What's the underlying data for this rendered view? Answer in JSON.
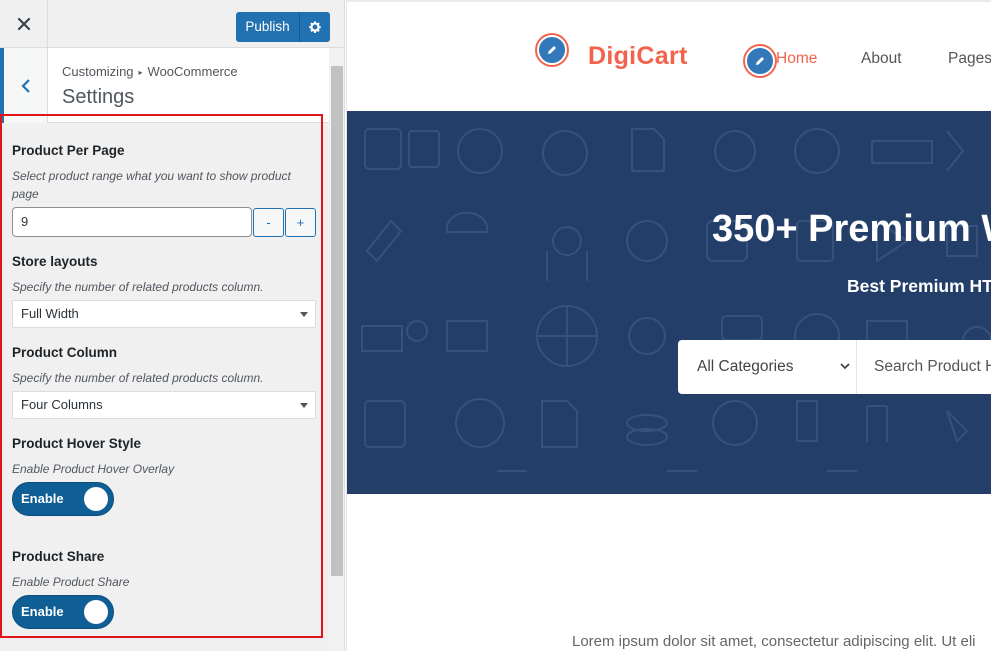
{
  "topbar": {
    "close_icon": "close-icon",
    "publish_label": "Publish",
    "settings_icon": "gear-icon"
  },
  "section": {
    "breadcrumb_root": "Customizing",
    "breadcrumb_current": "WooCommerce",
    "title": "Settings"
  },
  "controls": {
    "per_page": {
      "title": "Product Per Page",
      "description": "Select product range what you want to show product page",
      "value": "9",
      "decrement": "-",
      "increment": "+"
    },
    "store_layout": {
      "title": "Store layouts",
      "description": "Specify the number of related products column.",
      "selected": "Full Width"
    },
    "product_column": {
      "title": "Product Column",
      "description": "Specify the number of related products column.",
      "selected": "Four Columns"
    },
    "hover_style": {
      "title": "Product Hover Style",
      "description": "Enable Product Hover Overlay",
      "toggle_label": "Enable",
      "enabled": true
    },
    "share": {
      "title": "Product Share",
      "description": "Enable Product Share",
      "toggle_label": "Enable",
      "enabled": true
    }
  },
  "preview": {
    "logo": "DigiCart",
    "nav": [
      "Home",
      "About",
      "Pages"
    ],
    "hero_title": "350+ Premium W",
    "hero_subtitle": "Best Premium HT",
    "search": {
      "category": "All Categories",
      "placeholder": "Search Product H"
    },
    "body_text": "Lorem ipsum dolor sit amet, consectetur adipiscing elit. Ut eli"
  },
  "colors": {
    "accent": "#2271b1",
    "brand": "#f2634b",
    "hero_bg": "#233f69",
    "highlight": "#e0141b",
    "toggle": "#0f5f96"
  }
}
